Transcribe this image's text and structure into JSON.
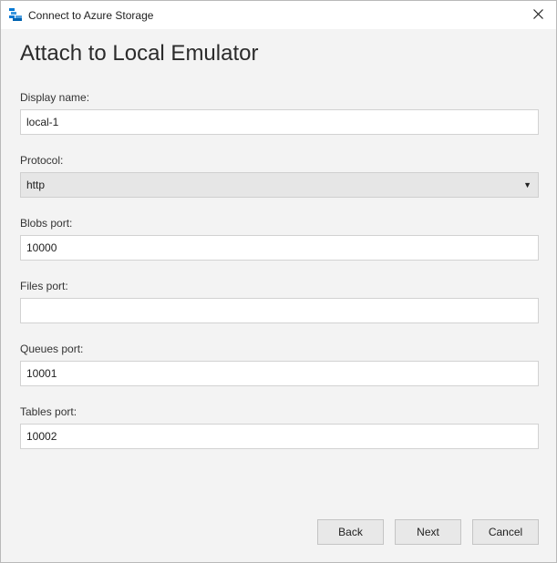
{
  "window": {
    "title": "Connect to Azure Storage",
    "close_glyph": "✕"
  },
  "heading": "Attach to Local Emulator",
  "fields": {
    "display_name": {
      "label": "Display name:",
      "value": "local-1",
      "placeholder": ""
    },
    "protocol": {
      "label": "Protocol:",
      "value": "http",
      "arrow": "▼"
    },
    "blobs_port": {
      "label": "Blobs port:",
      "value": "10000",
      "placeholder": ""
    },
    "files_port": {
      "label": "Files port:",
      "value": "",
      "placeholder": ""
    },
    "queues_port": {
      "label": "Queues port:",
      "value": "10001",
      "placeholder": ""
    },
    "tables_port": {
      "label": "Tables port:",
      "value": "10002",
      "placeholder": ""
    }
  },
  "buttons": {
    "back": "Back",
    "next": "Next",
    "cancel": "Cancel"
  },
  "icons": {
    "app": "azure-storage-icon",
    "close": "close-icon",
    "dropdown": "chevron-down-icon"
  }
}
